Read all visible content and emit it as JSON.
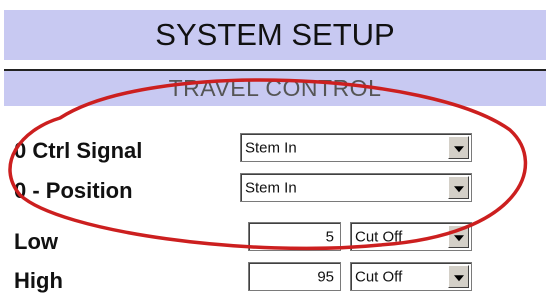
{
  "header": {
    "title": "SYSTEM SETUP"
  },
  "section": {
    "title": "TRAVEL CONTROL"
  },
  "rows": [
    {
      "label": "0 Ctrl Signal",
      "select": "Stem In"
    },
    {
      "label": "0 - Position",
      "select": "Stem In"
    },
    {
      "label": "Low",
      "value": "5",
      "select": "Cut Off"
    },
    {
      "label": "High",
      "value": "95",
      "select": "Cut Off"
    }
  ],
  "colors": {
    "header_bg": "#c8c9f2",
    "annotation_ellipse": "#cc1f1f"
  }
}
